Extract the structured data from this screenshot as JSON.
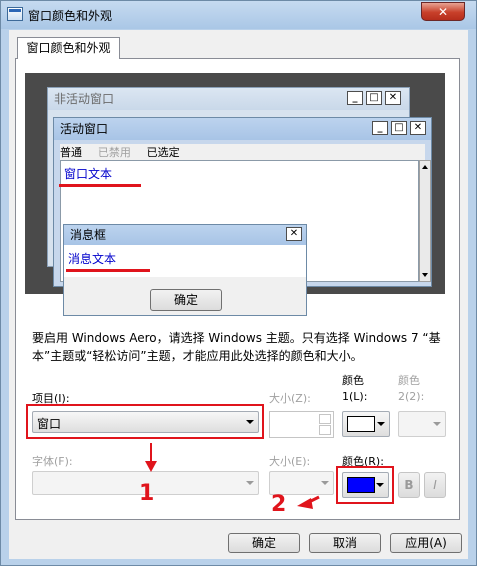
{
  "window": {
    "title": "窗口颜色和外观",
    "close_label": "✕"
  },
  "tab": {
    "label": "窗口颜色和外观"
  },
  "preview": {
    "inactive_title": "非活动窗口",
    "active_title": "活动窗口",
    "menu": [
      "普通",
      "已禁用",
      "已选定"
    ],
    "window_text": "窗口文本",
    "message_title": "消息框",
    "message_text": "消息文本",
    "ok_label": "确定"
  },
  "description": "要启用 Windows Aero，请选择 Windows 主题。只有选择 Windows 7 “基本”主题或“轻松访问”主题，才能应用此处选择的颜色和大小。",
  "item": {
    "label": "项目(I):",
    "value": "窗口"
  },
  "size1": {
    "label": "大小(Z):"
  },
  "color1": {
    "label_a": "颜色",
    "label_b": "1(L):",
    "swatch": "#ffffff"
  },
  "color2": {
    "label_a": "颜色",
    "label_b": "2(2):"
  },
  "font": {
    "label": "字体(F):"
  },
  "size2": {
    "label": "大小(E):"
  },
  "colorR": {
    "label": "颜色(R):",
    "swatch": "#0000ff"
  },
  "bold_label": "B",
  "italic_label": "I",
  "annotations": {
    "one": "1",
    "two": "2"
  },
  "buttons": {
    "ok": "确定",
    "cancel": "取消",
    "apply": "应用(A)"
  },
  "colors": {
    "accent_red": "#e0141c",
    "link_blue": "#0000cc"
  }
}
